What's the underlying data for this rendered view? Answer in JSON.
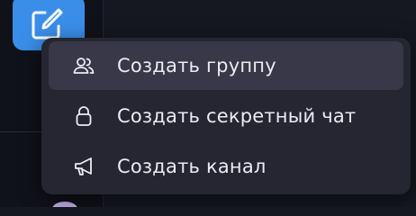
{
  "menu": {
    "items": [
      {
        "label": "Создать группу",
        "icon": "group-icon",
        "active": true
      },
      {
        "label": "Создать секретный чат",
        "icon": "lock-icon",
        "active": false
      },
      {
        "label": "Создать канал",
        "icon": "megaphone-icon",
        "active": false
      }
    ]
  },
  "compose_button": {
    "icon": "compose-icon"
  },
  "colors": {
    "accent": "#3b8ee8",
    "menu_background": "#252632",
    "menu_hover": "#393848",
    "text": "#eceaf2",
    "page_background": "#151821"
  }
}
